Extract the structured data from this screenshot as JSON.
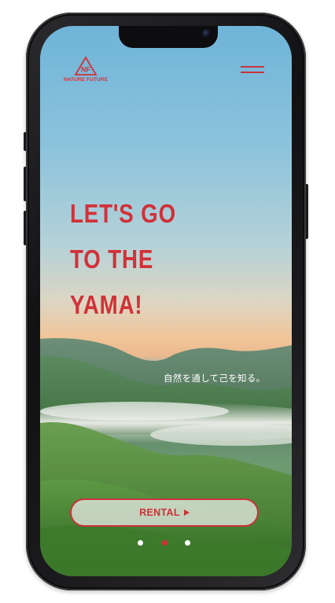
{
  "brand": {
    "name": "NATURE FUTURE",
    "mark": "NF",
    "color": "#d3323a"
  },
  "header": {
    "menu_icon": "hamburger-icon"
  },
  "hero": {
    "headline_lines": [
      "LET'S GO",
      "TO THE",
      "YAMA!"
    ],
    "subtitle": "自然を通して己を知る。"
  },
  "cta": {
    "label": "RENTAL",
    "arrow_icon": "play-triangle-icon"
  },
  "carousel": {
    "count": 3,
    "active_index": 1
  },
  "colors": {
    "accent": "#d13138",
    "sky_top": "#6fb4d8",
    "sunset": "#f1c498",
    "grass": "#4f8a3c"
  }
}
